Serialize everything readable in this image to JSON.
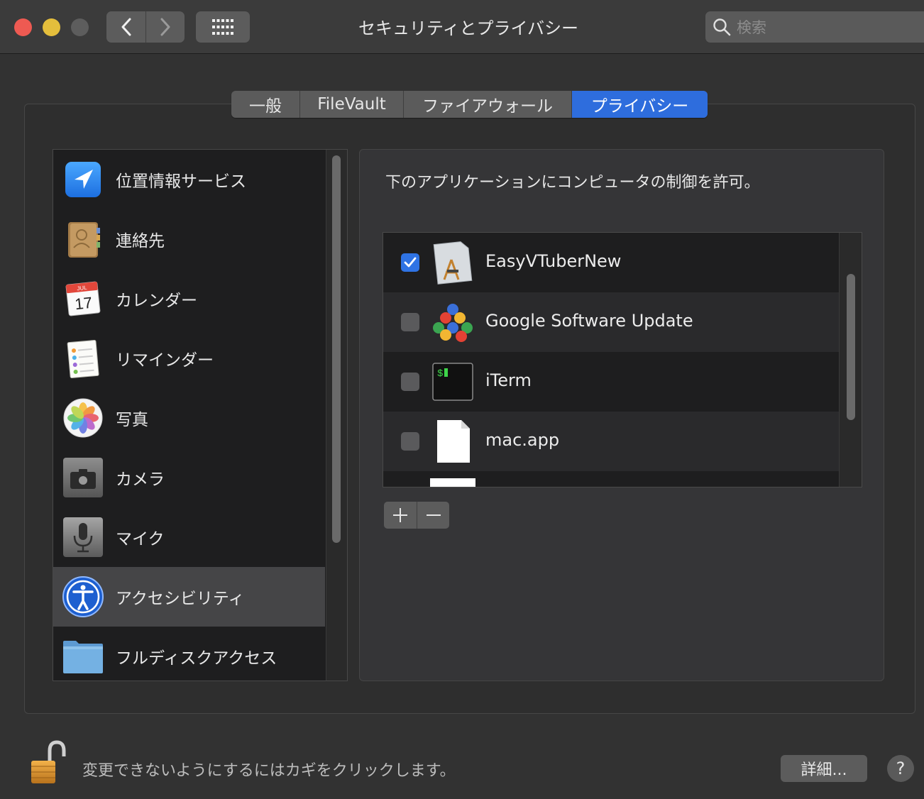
{
  "window": {
    "title": "セキュリティとプライバシー",
    "search_placeholder": "検索"
  },
  "tabs": [
    {
      "label": "一般",
      "active": false
    },
    {
      "label": "FileVault",
      "active": false
    },
    {
      "label": "ファイアウォール",
      "active": false
    },
    {
      "label": "プライバシー",
      "active": true
    }
  ],
  "sidebar": {
    "items": [
      {
        "label": "位置情報サービス",
        "icon": "location-arrow-icon"
      },
      {
        "label": "連絡先",
        "icon": "contacts-book-icon"
      },
      {
        "label": "カレンダー",
        "icon": "calendar-icon",
        "month": "JUL",
        "day": "17"
      },
      {
        "label": "リマインダー",
        "icon": "reminders-icon"
      },
      {
        "label": "写真",
        "icon": "photos-icon"
      },
      {
        "label": "カメラ",
        "icon": "camera-icon"
      },
      {
        "label": "マイク",
        "icon": "microphone-icon"
      },
      {
        "label": "アクセシビリティ",
        "icon": "accessibility-icon",
        "selected": true
      },
      {
        "label": "フルディスクアクセス",
        "icon": "folder-icon"
      }
    ]
  },
  "main": {
    "description": "下のアプリケーションにコンピュータの制御を許可。",
    "apps": [
      {
        "name": "EasyVTuberNew",
        "checked": true,
        "icon": "app-document-icon"
      },
      {
        "name": "Google Software Update",
        "checked": false,
        "icon": "google-software-update-icon"
      },
      {
        "name": "iTerm",
        "checked": false,
        "icon": "terminal-icon",
        "prompt": "$"
      },
      {
        "name": "mac.app",
        "checked": false,
        "icon": "blank-document-icon"
      }
    ],
    "add_symbol": "+",
    "remove_symbol": "−"
  },
  "footer": {
    "lock_message": "変更できないようにするにはカギをクリックします。",
    "details_label": "詳細...",
    "help_label": "?"
  },
  "colors": {
    "accent": "#2e6ddd",
    "close": "#ee5a52",
    "minimize": "#e4be3c"
  }
}
